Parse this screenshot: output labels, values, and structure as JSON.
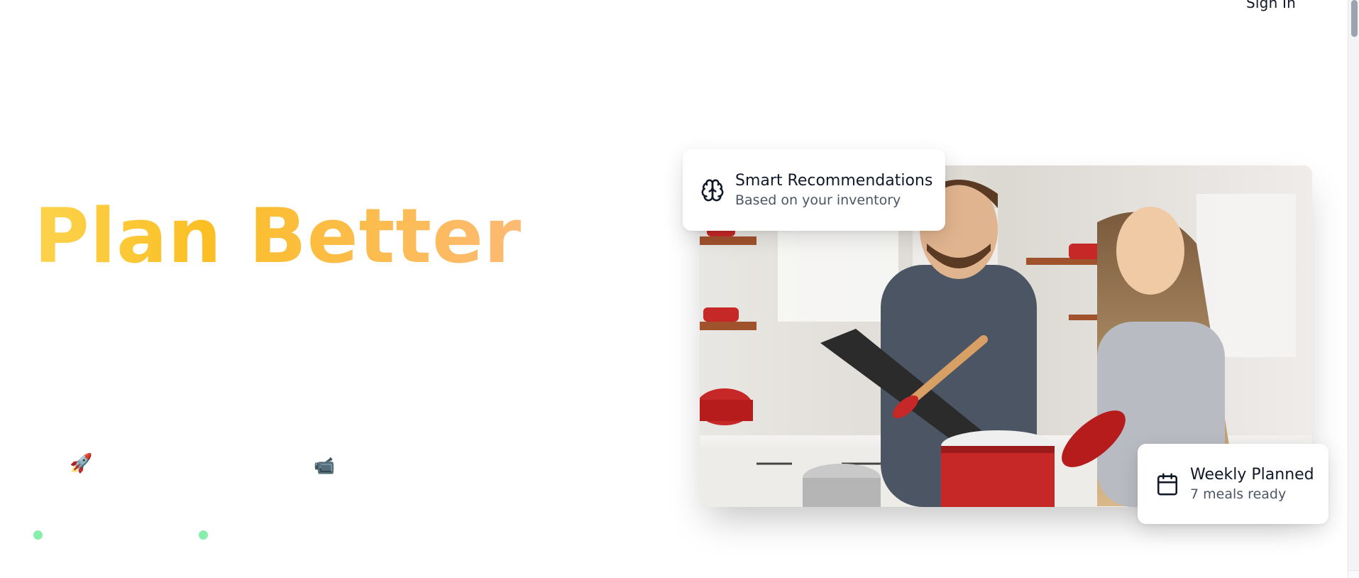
{
  "header": {
    "signin_label": "Sign In"
  },
  "hero": {
    "title": "Plan Better",
    "title_gradient": [
      "#fcd34d",
      "#fbbf24",
      "#fdba74"
    ]
  },
  "decorations": {
    "rocket_emoji": "🚀",
    "camera_emoji": "📹",
    "dot_color": "#86efac"
  },
  "cards": {
    "recommendations": {
      "icon": "brain-icon",
      "title": "Smart Recommendations",
      "subtitle": "Based on your inventory"
    },
    "weekly": {
      "icon": "calendar-icon",
      "title": "Weekly Planned",
      "subtitle": "7 meals ready"
    }
  },
  "colors": {
    "text_primary": "#111827",
    "text_secondary": "#4b5563",
    "background": "#ffffff"
  }
}
